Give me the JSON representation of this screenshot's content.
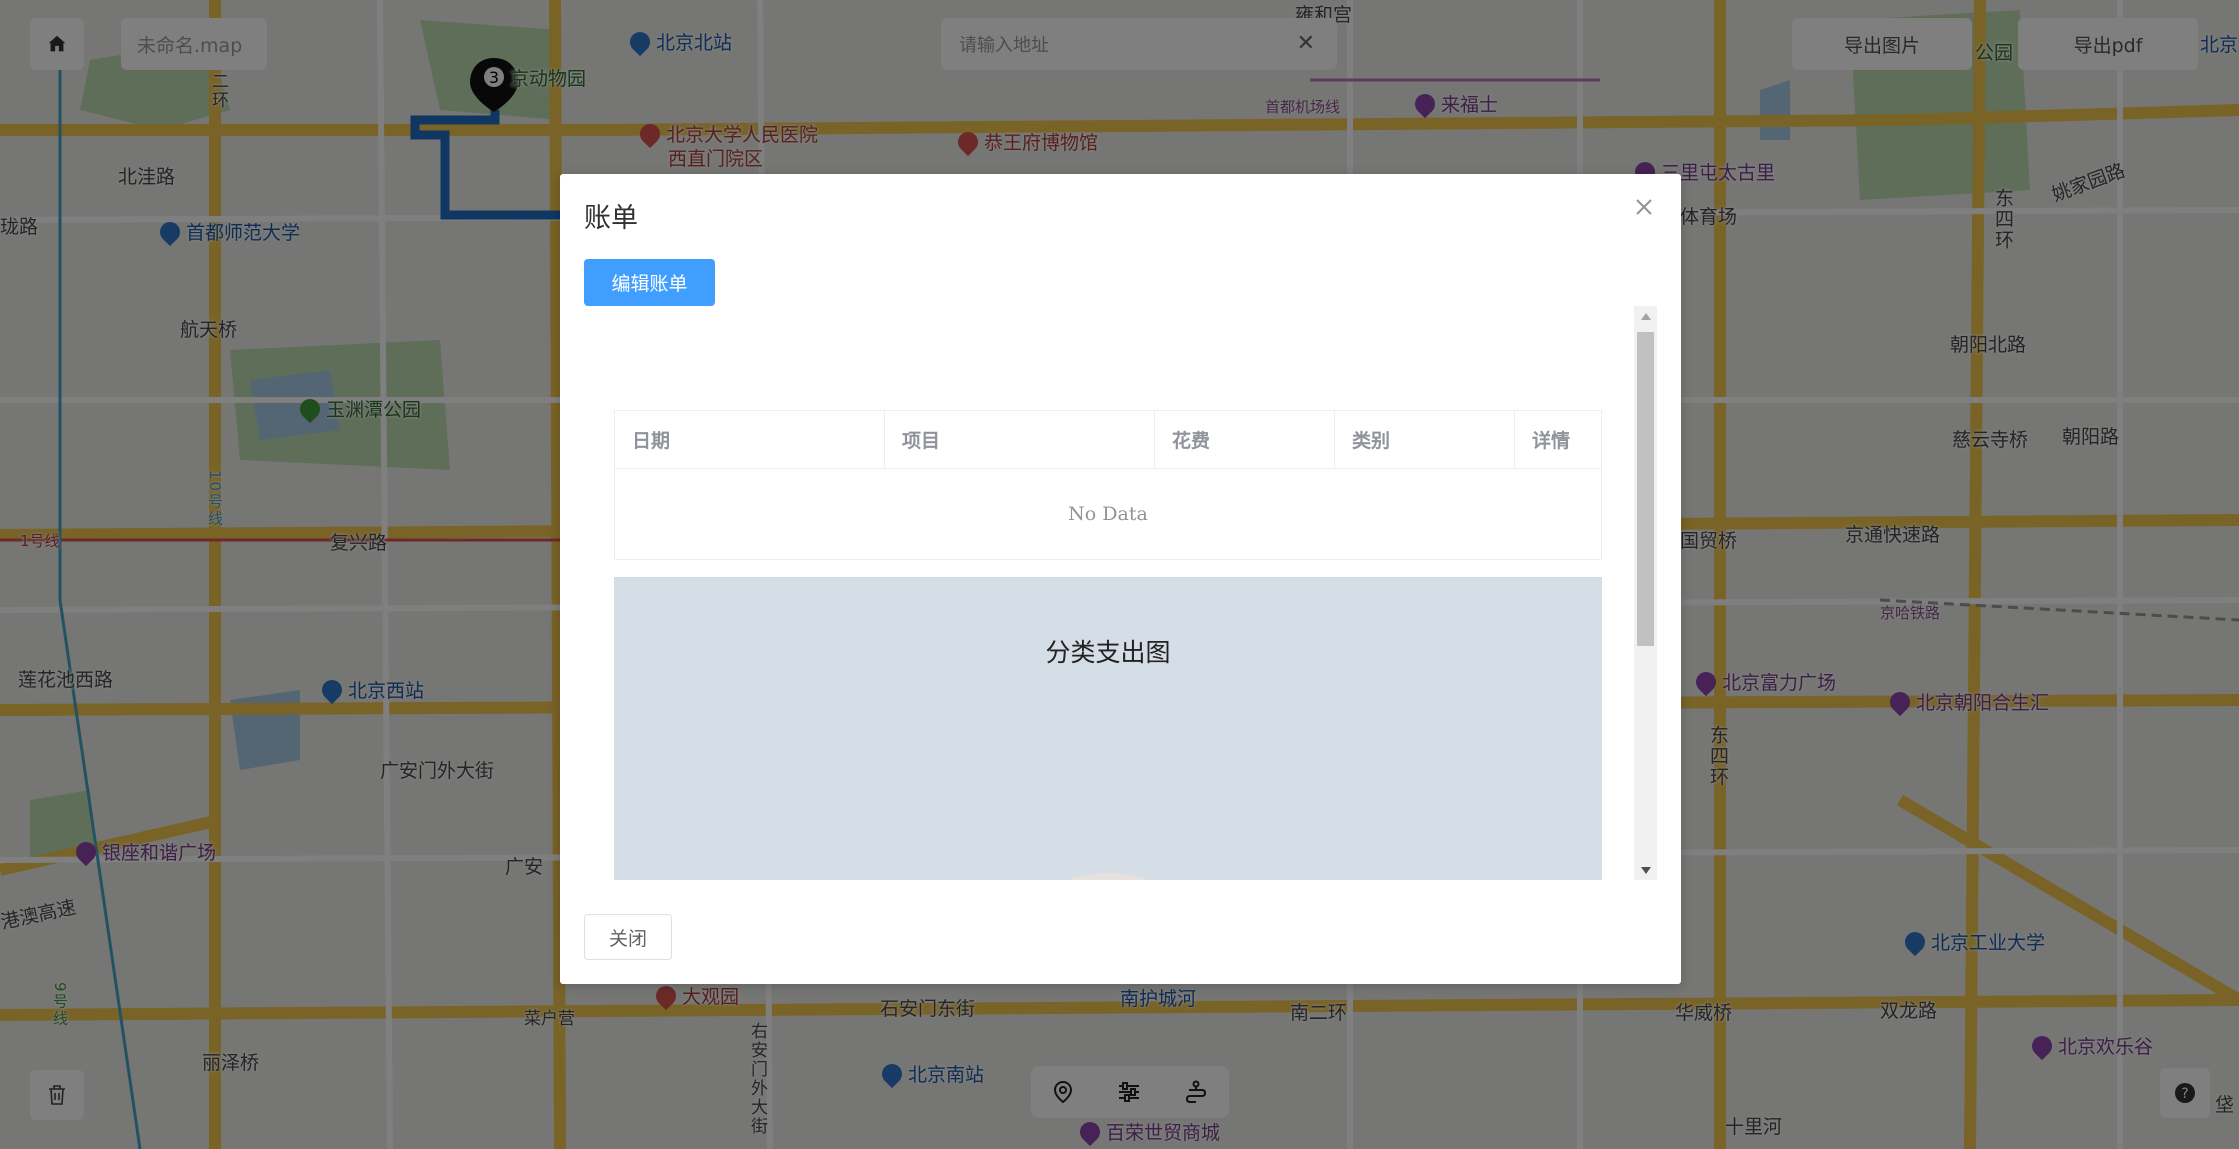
{
  "app": {
    "home_icon": "home-icon",
    "file_title": "未命名.map",
    "search": {
      "placeholder": "请输入地址",
      "clear_icon": "close-icon"
    },
    "export_image_label": "导出图片",
    "export_pdf_label": "导出pdf"
  },
  "map": {
    "labels": [
      "北京北站",
      "京动物园",
      "北京大学人民医院",
      "西直门院区",
      "恭王府博物馆",
      "雍和宫",
      "来福士",
      "首都机场线",
      "三里屯太古里",
      "体育场",
      "公园",
      "北京",
      "姚家园路",
      "东四环",
      "北洼路",
      "首都师范大学",
      "航天桥",
      "朝阳北路",
      "玉渊潭公园",
      "慈云寺桥",
      "朝阳路",
      "1号线",
      "复兴路",
      "国贸桥",
      "京通快速路",
      "东四环",
      "京哈铁路",
      "莲花池西路",
      "北京西站",
      "北京富力广场",
      "北京朝阳合生汇",
      "广安门外大街",
      "广安",
      "银座和谐广场",
      "港澳高速",
      "北京工业大学",
      "大观园",
      "菜户营",
      "石安门东街",
      "南护城河",
      "南二环",
      "华威桥",
      "双龙路",
      "北京欢乐谷",
      "丽泽桥",
      "北京南站",
      "右安门外大街",
      "百荣世贸商城",
      "十里河",
      "9号线",
      "10号线",
      "二环",
      "珑路",
      "垡"
    ],
    "route_stop_number": "3"
  },
  "dialog": {
    "title": "账单",
    "close_icon": "close-icon",
    "edit_button_label": "编辑账单",
    "table": {
      "columns": [
        "日期",
        "项目",
        "花费",
        "类别",
        "详情"
      ],
      "rows": [],
      "empty_text": "No Data"
    },
    "chart": {
      "title": "分类支出图"
    },
    "footer_close_label": "关闭"
  },
  "bottom_toolbar": {
    "tools": [
      "location-pin-icon",
      "sliders-icon",
      "route-icon"
    ],
    "trash_icon": "trash-icon",
    "help_icon": "help-icon"
  },
  "colors": {
    "primary": "#409eff",
    "mask": "rgba(0,0,0,0.5)",
    "chart_bg": "#d5dde6",
    "route": "#1f6fc5"
  }
}
